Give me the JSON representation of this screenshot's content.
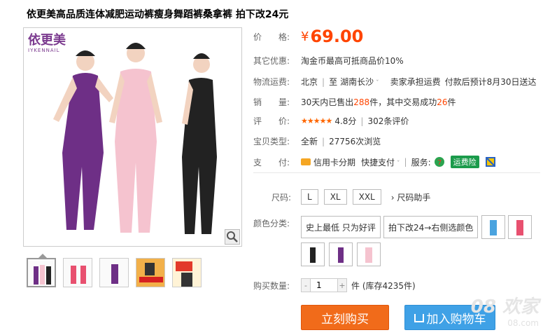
{
  "title": "依更美高品质连体减肥运动裤瘦身舞蹈裤桑拿裤 拍下改24元",
  "brand": {
    "name_cn": "依更美",
    "name_en": "IYKENNAIL"
  },
  "price": {
    "label": "价　　格:",
    "symbol": "¥",
    "value": "69.00"
  },
  "discount": {
    "label": "其它优惠:",
    "text": "淘金币最高可抵商品价10%"
  },
  "shipping": {
    "label": "物流运费:",
    "from": "北京",
    "to_word": "至",
    "to": "湖南长沙",
    "fee": "卖家承担运费",
    "estimate": "付款后预计8月30日送达"
  },
  "sales": {
    "label": "销　　量:",
    "prefix": "30天内已售出",
    "sold": "288",
    "unit1": "件，其中交易成功",
    "success": "26",
    "unit2": "件"
  },
  "rating": {
    "label": "评　　价:",
    "stars": "★★★★★",
    "score": "4.8分",
    "reviews": "302条评价"
  },
  "type": {
    "label": "宝贝类型:",
    "value": "全新",
    "views": "27756次浏览"
  },
  "payment": {
    "label": "支　　付:",
    "credit": "信用卡分期",
    "quick": "快捷支付",
    "service_label": "服务:",
    "badge": "运费险"
  },
  "size": {
    "label": "尺码:",
    "options": [
      "L",
      "XL",
      "XXL"
    ],
    "helper": "尺码助手"
  },
  "color": {
    "label": "颜色分类:",
    "text_options": [
      "史上最低 只为好评",
      "拍下改24→右侧选颜色"
    ]
  },
  "quantity": {
    "label": "购买数量:",
    "minus": "-",
    "value": "1",
    "plus": "+",
    "stock": "件 (库存4235件)"
  },
  "buttons": {
    "buy": "立刻购买",
    "cart": "加入购物车"
  },
  "watermark": {
    "big": "08 欢家",
    "small": "08.com"
  },
  "colors": {
    "accent_orange": "#f40",
    "buy_bg": "#f16b1a",
    "cart_bg": "#3fa1e6",
    "purple": "#6e2f86",
    "pink": "#f5c3cf",
    "black": "#222222"
  },
  "icons": {
    "zoom": "magnifier-icon",
    "card": "credit-card-icon",
    "cart": "cart-icon"
  }
}
